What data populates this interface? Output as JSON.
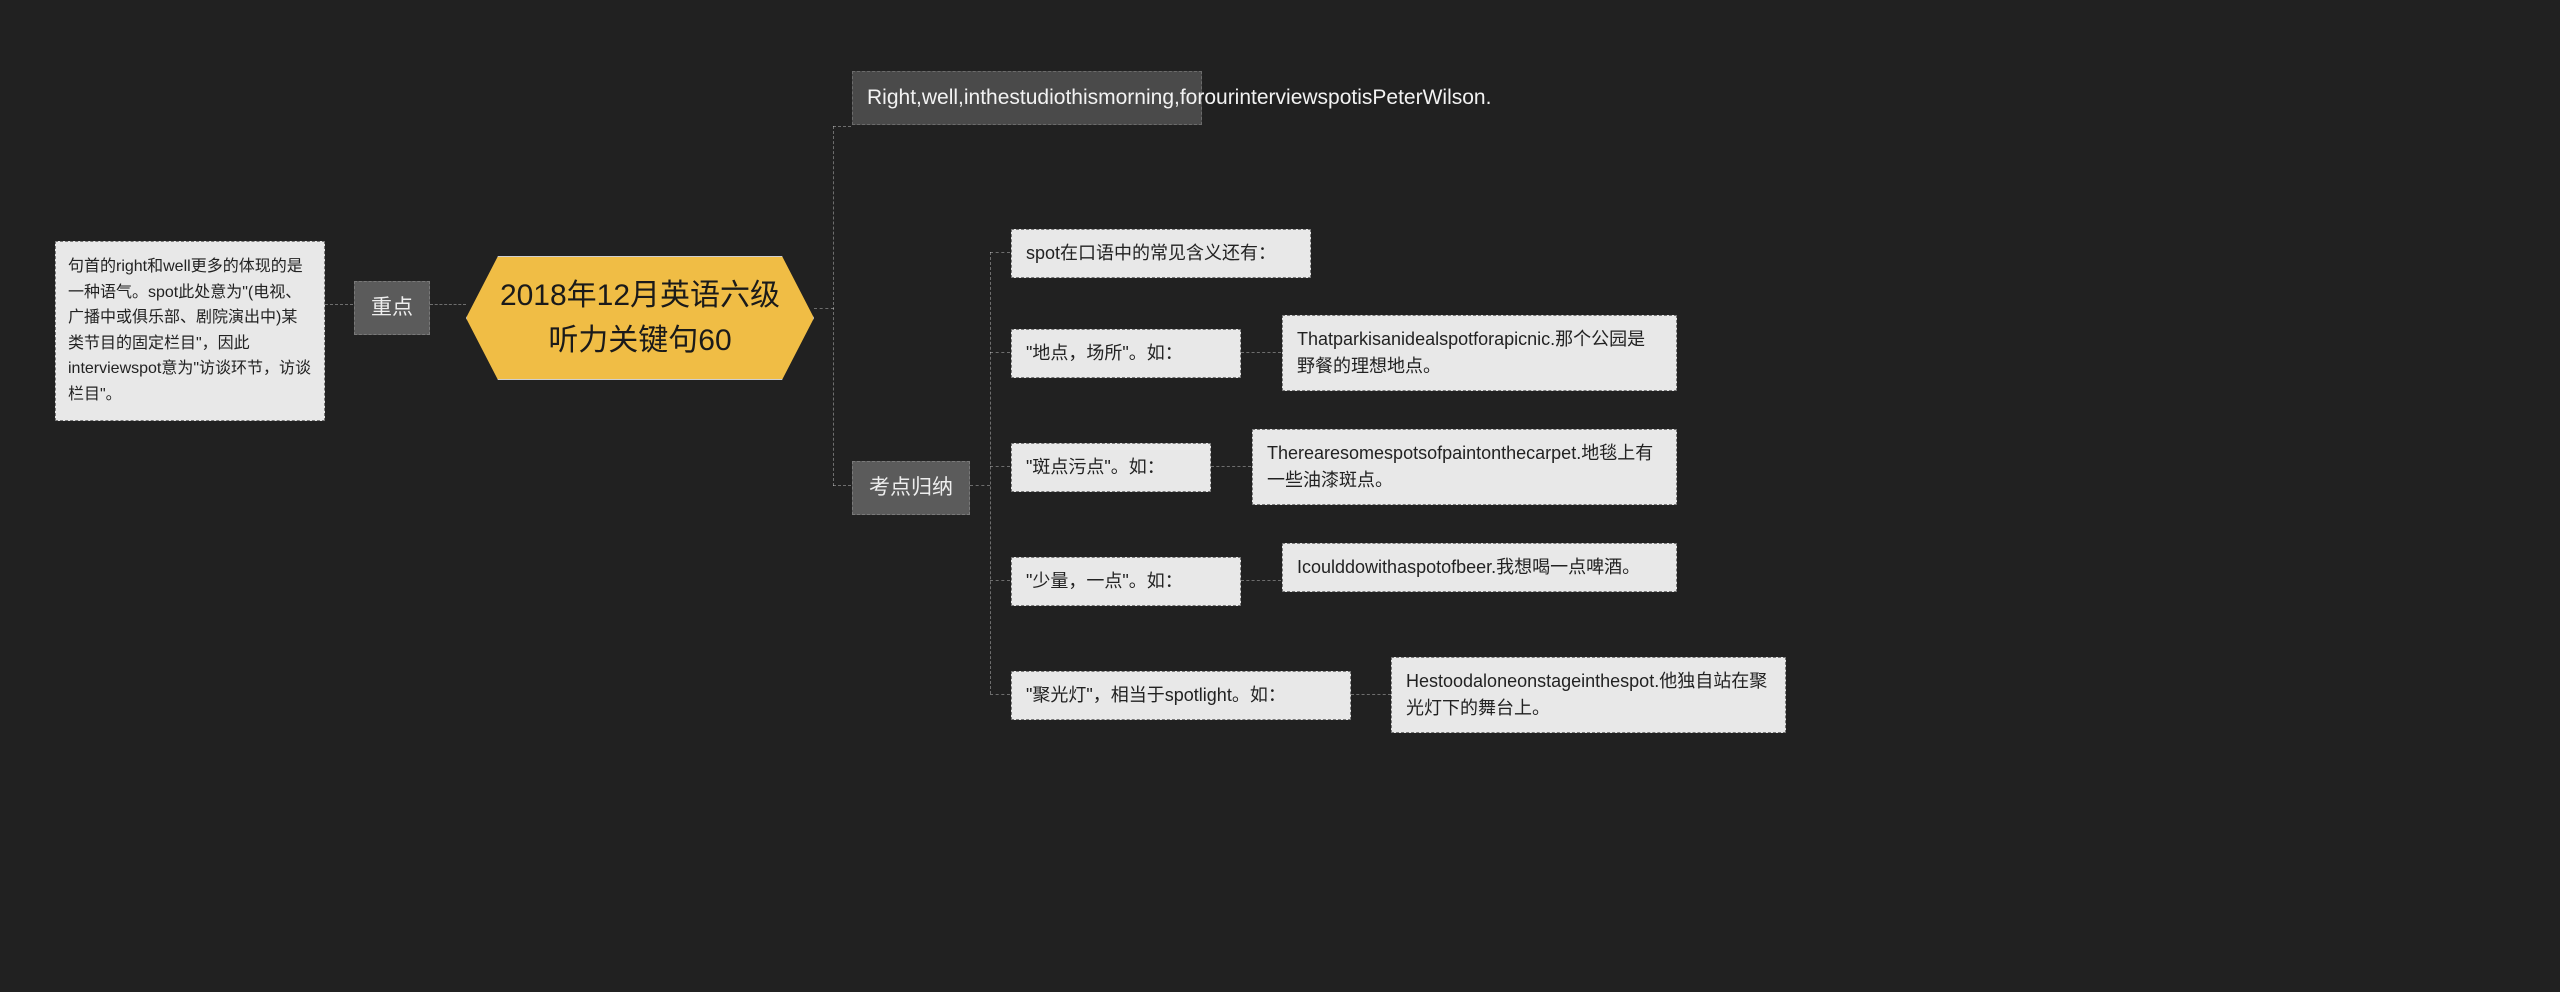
{
  "center": {
    "title": "2018年12月英语六级听力关键句60"
  },
  "left": {
    "label": "重点",
    "detail": "句首的right和well更多的体现的是一种语气。spot此处意为\"(电视、广播中或俱乐部、剧院演出中)某类节目的固定栏目\"，因此interviewspot意为\"访谈环节，访谈栏目\"。"
  },
  "right": {
    "sample": "Right,well,inthestudiothismorning,forourinterviewspotisPeterWilson.",
    "section_label": "考点归纳",
    "intro": "spot在口语中的常见含义还有：",
    "items": [
      {
        "term": "\"地点，场所\"。如：",
        "example": "Thatparkisanidealspotforapicnic.那个公园是野餐的理想地点。"
      },
      {
        "term": "\"斑点污点\"。如：",
        "example": "Therearesomespotsofpaintonthecarpet.地毯上有一些油漆斑点。"
      },
      {
        "term": "\"少量，一点\"。如：",
        "example": "Icoulddowithaspotofbeer.我想喝一点啤酒。"
      },
      {
        "term": "\"聚光灯\"，相当于spotlight。如：",
        "example": "Hestoodaloneonstageinthespot.他独自站在聚光灯下的舞台上。"
      }
    ]
  }
}
